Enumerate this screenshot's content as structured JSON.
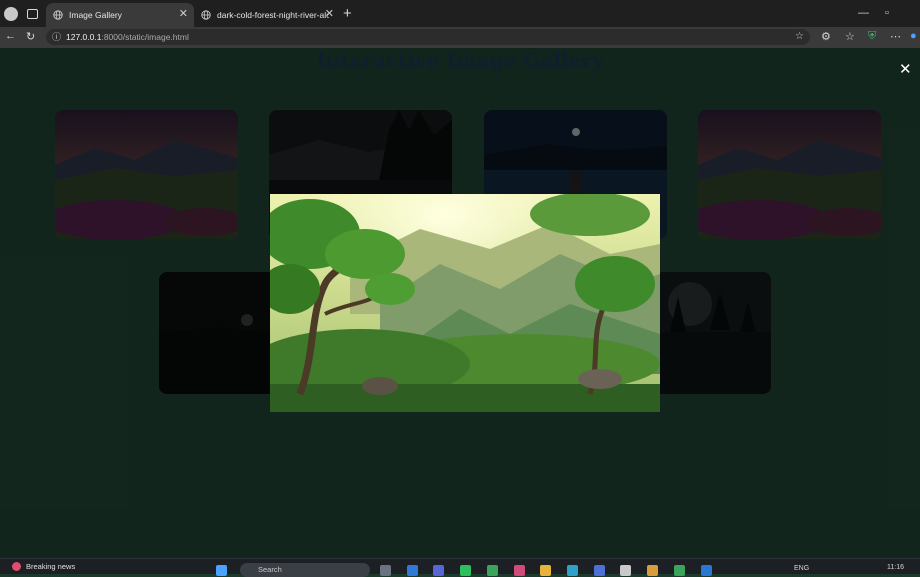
{
  "browser": {
    "tabs": [
      {
        "label": "Image Gallery",
        "active": true
      },
      {
        "label": "dark-cold-forest-night-river-alon",
        "active": false
      }
    ],
    "url_host": "127.0.0.1",
    "url_path": ":8000/static/image.html",
    "icons": [
      "profile-avatar-icon",
      "tabs-icon",
      "globe-icon",
      "close-icon",
      "new-tab-icon",
      "minimize-icon",
      "restore-icon",
      "back-icon",
      "reload-icon",
      "info-icon",
      "favorite-star-icon",
      "extensions-icon",
      "favorites-icon",
      "shield-icon",
      "more-icon",
      "copilot-icon"
    ]
  },
  "page": {
    "title": "Interactive Image Gallery",
    "close_label": "✕",
    "thumbnails": [
      {
        "name": "flower-valley-sunset"
      },
      {
        "name": "dark-mountain-lake"
      },
      {
        "name": "night-lake-pier"
      },
      {
        "name": "flower-valley-sunset"
      },
      {
        "name": "dark-moon-hills"
      },
      {
        "name": "dark-forest-moon"
      }
    ],
    "modal_image": {
      "name": "green-valley-trees"
    },
    "colors": {
      "background": "#1d3a2d",
      "title": "#1a2e47"
    }
  },
  "taskbar": {
    "news_label": "Breaking news",
    "search_placeholder": "Search",
    "language": "ENG",
    "time": "11:16"
  }
}
